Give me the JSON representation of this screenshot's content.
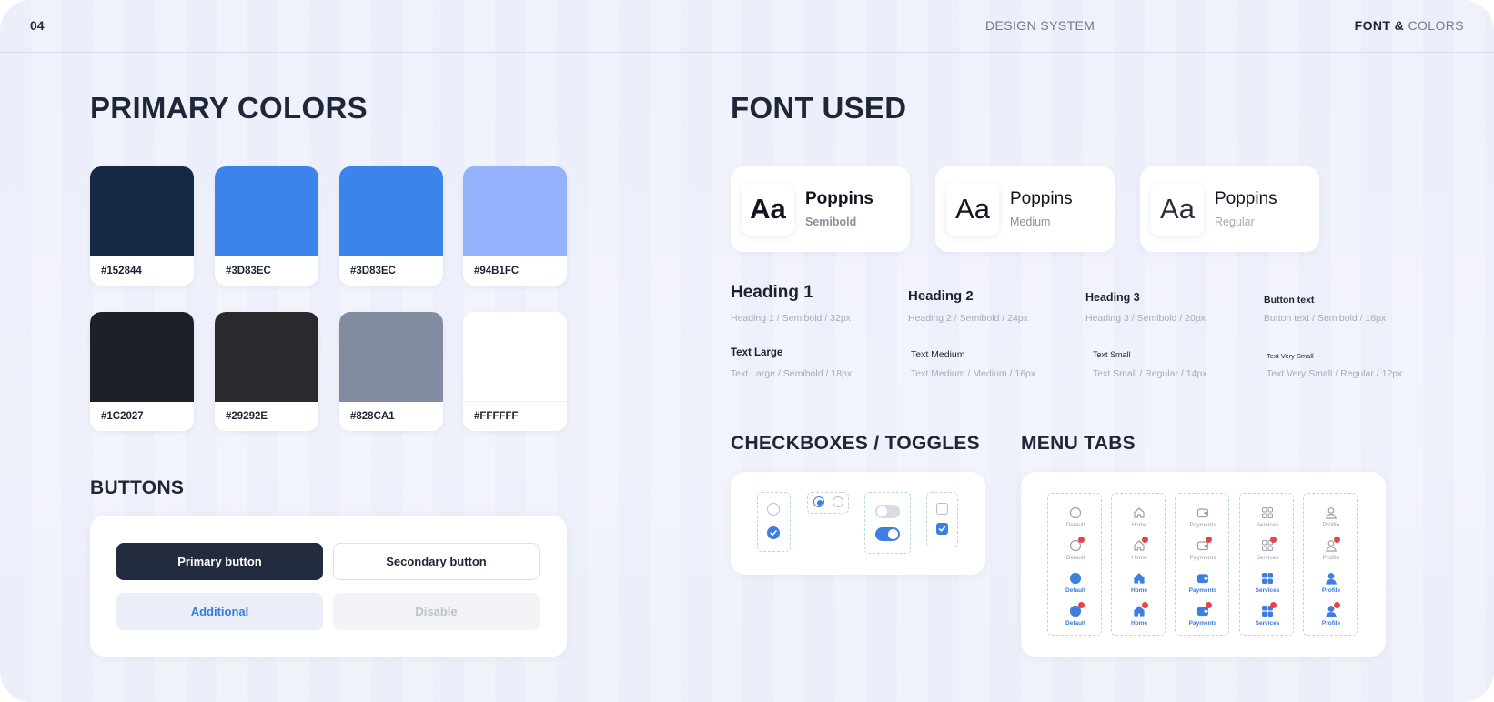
{
  "header": {
    "page_number": "04",
    "center_title": "DESIGN SYSTEM",
    "right_part1": "FONT & ",
    "right_part2": "COLORS"
  },
  "primary_colors": {
    "title": "PRIMARY COLORS",
    "swatches": [
      {
        "hex": "#152844",
        "color": "#152844"
      },
      {
        "hex": "#3D83EC",
        "color": "#3d83ec"
      },
      {
        "hex": "#3D83EC",
        "color": "#3d83ec"
      },
      {
        "hex": "#94B1FC",
        "color": "#94b1fc"
      },
      {
        "hex": "#1C2027",
        "color": "#1c2027"
      },
      {
        "hex": "#29292E",
        "color": "#29292e"
      },
      {
        "hex": "#828CA1",
        "color": "#828ca1"
      },
      {
        "hex": "#FFFFFF",
        "color": "#ffffff"
      }
    ]
  },
  "buttons": {
    "title": "BUTTONS",
    "primary": "Primary button",
    "secondary": "Secondary button",
    "additional": "Additional",
    "disable": "Disable"
  },
  "fonts": {
    "title": "FONT USED",
    "cards": [
      {
        "sample": "Aa",
        "name": "Poppins",
        "weight": "Semibold"
      },
      {
        "sample": "Aa",
        "name": "Poppins",
        "weight": "Medium"
      },
      {
        "sample": "Aa",
        "name": "Poppins",
        "weight": "Regular"
      }
    ],
    "styles": [
      {
        "label": "Heading 1",
        "spec": "Heading 1 / Semibold / 32px"
      },
      {
        "label": "Heading 2",
        "spec": "Heading 2 / Semibold / 24px"
      },
      {
        "label": "Heading 3",
        "spec": "Heading 3 / Semibold / 20px"
      },
      {
        "label": "Button text",
        "spec": "Button text / Semibold / 16px"
      },
      {
        "label": "Text Large",
        "spec": "Text Large / Semibold / 18px"
      },
      {
        "label": "Text Medium",
        "spec": "Text Medium / Medium / 16px"
      },
      {
        "label": "Text Small",
        "spec": "Text Small / Regular / 14px"
      },
      {
        "label": "Text Very Small",
        "spec": "Text Very Small / Regular / 12px"
      }
    ]
  },
  "checkboxes": {
    "title": "CHECKBOXES / TOGGLES"
  },
  "menu_tabs": {
    "title": "MENU TABS",
    "columns": [
      {
        "icon": "circle-icon",
        "labels": [
          "Default",
          "Default",
          "Default",
          "Default"
        ]
      },
      {
        "icon": "home-icon",
        "labels": [
          "Home",
          "Home",
          "Home",
          "Home"
        ]
      },
      {
        "icon": "wallet-icon",
        "labels": [
          "Payments",
          "Payments",
          "Payments",
          "Payments"
        ]
      },
      {
        "icon": "grid-icon",
        "labels": [
          "Services",
          "Services",
          "Services",
          "Services"
        ]
      },
      {
        "icon": "user-icon",
        "labels": [
          "Profile",
          "Profile",
          "Profile",
          "Profile"
        ]
      }
    ]
  },
  "colors": {
    "accent": "#3d7fe0",
    "badge": "#e8434d",
    "inactive_icon": "#9aa0ab"
  }
}
